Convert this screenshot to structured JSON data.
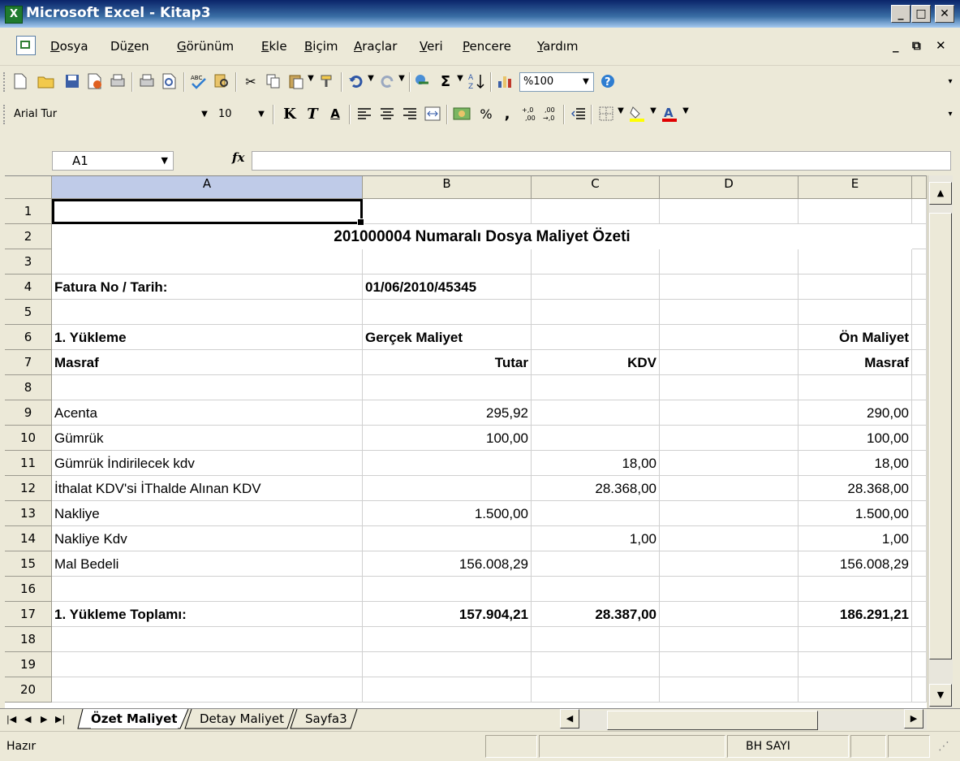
{
  "window": {
    "title": "Microsoft Excel - Kitap3",
    "app_icon": "excel-icon",
    "controls": {
      "minimize": "_",
      "maximize": "□",
      "close": "✕"
    }
  },
  "menubar": {
    "items": [
      {
        "pre": "",
        "u": "D",
        "post": "osya"
      },
      {
        "pre": "Dü",
        "u": "z",
        "post": "en"
      },
      {
        "pre": "",
        "u": "G",
        "post": "örünüm"
      },
      {
        "pre": "",
        "u": "E",
        "post": "kle"
      },
      {
        "pre": "",
        "u": "B",
        "post": "içim"
      },
      {
        "pre": "",
        "u": "A",
        "post": "raçlar"
      },
      {
        "pre": "",
        "u": "V",
        "post": "eri"
      },
      {
        "pre": "",
        "u": "P",
        "post": "encere"
      },
      {
        "pre": "",
        "u": "Y",
        "post": "ardım"
      }
    ],
    "doc_controls": {
      "minimize": "_",
      "restore": "🗗",
      "close": "✕"
    }
  },
  "standard_toolbar": {
    "zoom": "%100"
  },
  "formatting_toolbar": {
    "font": "Arial Tur",
    "size": "10",
    "bold": "K",
    "italic": "T",
    "underline": "A",
    "percent": "%",
    "comma": ",",
    "inc_decimal": "⁺⁰,₀₀",
    "dec_decimal": ",₀₀→,₀"
  },
  "formula_bar": {
    "name_box": "A1",
    "fx": "fx",
    "content": ""
  },
  "columns": [
    "A",
    "B",
    "C",
    "D",
    "E"
  ],
  "selected_column": "A",
  "rows": [
    "1",
    "2",
    "3",
    "4",
    "5",
    "6",
    "7",
    "8",
    "9",
    "10",
    "11",
    "12",
    "13",
    "14",
    "15",
    "16",
    "17",
    "18",
    "19",
    "20"
  ],
  "title_row": "201000004 Numaralı Dosya Maliyet Özeti",
  "cells": {
    "r4": {
      "a": "Fatura No / Tarih:",
      "b": "01/06/2010/45345"
    },
    "r6": {
      "a": "1. Yükleme",
      "b": "Gerçek Maliyet",
      "e": "Ön Maliyet"
    },
    "r7": {
      "a": "Masraf",
      "b": "Tutar",
      "c": "KDV",
      "e": "Masraf"
    },
    "r9": {
      "a": "Acenta",
      "b": "295,92",
      "e": "290,00"
    },
    "r10": {
      "a": "Gümrük",
      "b": "100,00",
      "e": "100,00"
    },
    "r11": {
      "a": "Gümrük İndirilecek kdv",
      "c": "18,00",
      "e": "18,00"
    },
    "r12": {
      "a": "İthalat KDV'si İThalde Alınan KDV",
      "c": "28.368,00",
      "e": "28.368,00"
    },
    "r13": {
      "a": "Nakliye",
      "b": "1.500,00",
      "e": "1.500,00"
    },
    "r14": {
      "a": "Nakliye Kdv",
      "c": "1,00",
      "e": "1,00"
    },
    "r15": {
      "a": "Mal Bedeli",
      "b": "156.008,29",
      "e": "156.008,29"
    },
    "r17": {
      "a": "1. Yükleme Toplamı:",
      "b": "157.904,21",
      "c": "28.387,00",
      "e": "186.291,21"
    }
  },
  "sheet_tabs": [
    "Özet Maliyet",
    "Detay Maliyet",
    "Sayfa3"
  ],
  "active_tab": "Özet Maliyet",
  "status": {
    "ready": "Hazır",
    "mode": "BH SAYI"
  }
}
